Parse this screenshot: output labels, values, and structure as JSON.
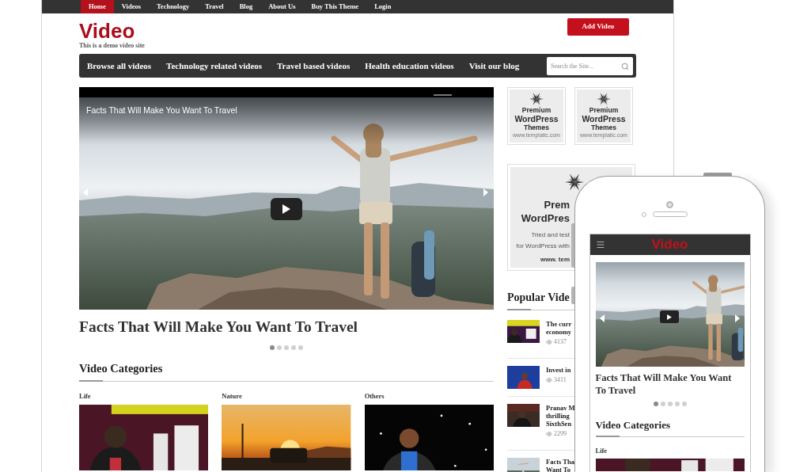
{
  "top_menu": [
    {
      "label": "Home",
      "selected": true
    },
    {
      "label": "Videos",
      "selected": false
    },
    {
      "label": "Technology",
      "selected": false
    },
    {
      "label": "Travel",
      "selected": false
    },
    {
      "label": "Blog",
      "selected": false
    },
    {
      "label": "About Us",
      "selected": false
    },
    {
      "label": "Buy This Theme",
      "selected": false
    },
    {
      "label": "Login",
      "selected": false
    }
  ],
  "header": {
    "logo": "Video",
    "tagline": "This is a demo video site",
    "button": "Add Video"
  },
  "main_nav": {
    "items": [
      "Browse all videos",
      "Technology related videos",
      "Travel based videos",
      "Health education videos",
      "Visit our blog"
    ],
    "search": {
      "placeholder": "Search the Site..."
    }
  },
  "slider": {
    "caption": "Facts That Will Make You Want To Travel",
    "title": "Facts That Will Make You Want To Travel",
    "dots": [
      {
        "selected": true
      },
      {
        "selected": false
      },
      {
        "selected": false
      },
      {
        "selected": false
      },
      {
        "selected": false
      }
    ]
  },
  "video_categories": {
    "heading": "Video Categories",
    "items": [
      {
        "label": "Life"
      },
      {
        "label": "Nature"
      },
      {
        "label": "Others"
      }
    ]
  },
  "sidebar": {
    "small_ads": [
      {
        "lines": [
          "Premium",
          "WordPress",
          "Themes"
        ],
        "url": "www.templatic.com"
      },
      {
        "lines": [
          "Premium",
          "WordPress",
          "Themes"
        ],
        "url": "www.templatic.com"
      }
    ],
    "large_ad": {
      "title_lines": [
        "Prem",
        "WordPres"
      ],
      "text_lines": [
        "Tried and test",
        "for WordPress with"
      ],
      "url": "www. tem"
    },
    "popular_videos": {
      "heading": "Popular Vide",
      "items": [
        {
          "title_lines": [
            "The curr",
            "economy"
          ],
          "views": "4137"
        },
        {
          "title_lines": [
            "Invest in"
          ],
          "views": "3411"
        },
        {
          "title_lines": [
            "Pranav M",
            "thrilling",
            "SixthSen"
          ],
          "views": "2299"
        },
        {
          "title_lines": [
            "Facts Tha",
            "Want To"
          ]
        }
      ]
    }
  },
  "phone": {
    "logo": "Video",
    "slide_title": "Facts That Will Make You Want To Travel",
    "dots": [
      {
        "selected": true
      },
      {
        "selected": false
      },
      {
        "selected": false
      },
      {
        "selected": false
      },
      {
        "selected": false
      }
    ],
    "categories_heading": "Video Categories",
    "categories": [
      {
        "label": "Life"
      }
    ]
  }
}
